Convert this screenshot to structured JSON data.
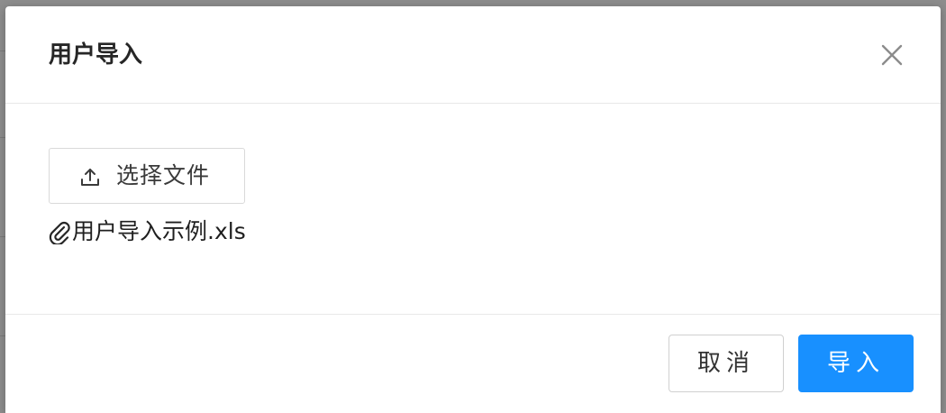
{
  "dialog": {
    "title": "用户导入",
    "close_icon": "close-icon"
  },
  "body": {
    "upload_button": {
      "label": "选择文件",
      "icon": "upload-icon"
    },
    "file": {
      "icon": "paperclip-icon",
      "name": "用户导入示例.xls"
    }
  },
  "footer": {
    "cancel_label": "取消",
    "import_label": "导入"
  },
  "colors": {
    "primary": "#1890ff",
    "border": "#d9d9d9",
    "divider": "#e8e8e8",
    "overlay": "#8d8d8d"
  }
}
